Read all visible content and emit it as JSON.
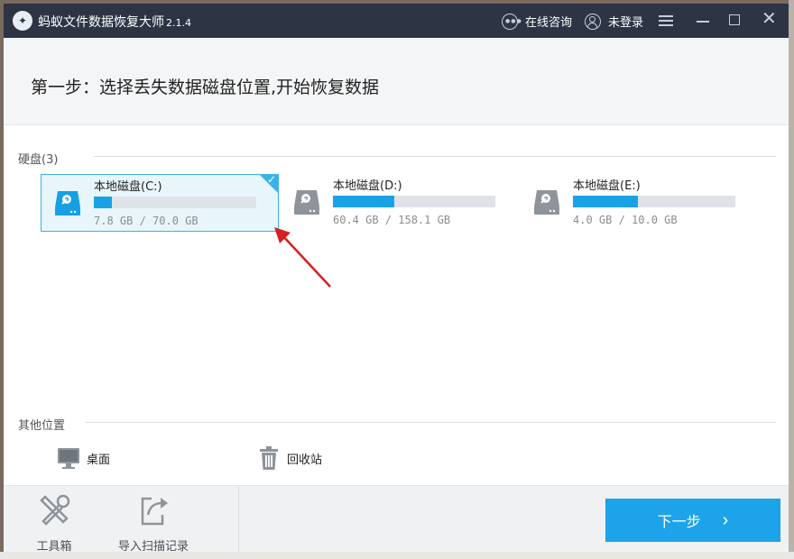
{
  "titlebar": {
    "app_name": "蚂蚁文件数据恢复大师",
    "version": "2.1.4",
    "consult_label": "在线咨询",
    "login_label": "未登录"
  },
  "header": {
    "step_title": "第一步：选择丢失数据磁盘位置,开始恢复数据"
  },
  "disks": {
    "section_label": "硬盘(3)",
    "items": [
      {
        "name": "本地磁盘(C:)",
        "size": "7.8 GB / 70.0 GB",
        "used_fraction": 0.11,
        "selected": true
      },
      {
        "name": "本地磁盘(D:)",
        "size": "60.4 GB / 158.1 GB",
        "used_fraction": 0.38,
        "selected": false
      },
      {
        "name": "本地磁盘(E:)",
        "size": "4.0 GB / 10.0 GB",
        "used_fraction": 0.4,
        "selected": false
      }
    ]
  },
  "other": {
    "section_label": "其他位置",
    "items": [
      {
        "label": "桌面",
        "icon": "monitor-icon"
      },
      {
        "label": "回收站",
        "icon": "trash-icon"
      }
    ]
  },
  "bottom": {
    "tools": [
      {
        "label": "工具箱",
        "icon": "tools-icon"
      },
      {
        "label": "导入扫描记录",
        "icon": "import-icon"
      }
    ],
    "next_label": "下一步"
  },
  "colors": {
    "titlebar": "#2d3545",
    "accent": "#19a3e6",
    "selected_bg": "#e8f6fb"
  }
}
